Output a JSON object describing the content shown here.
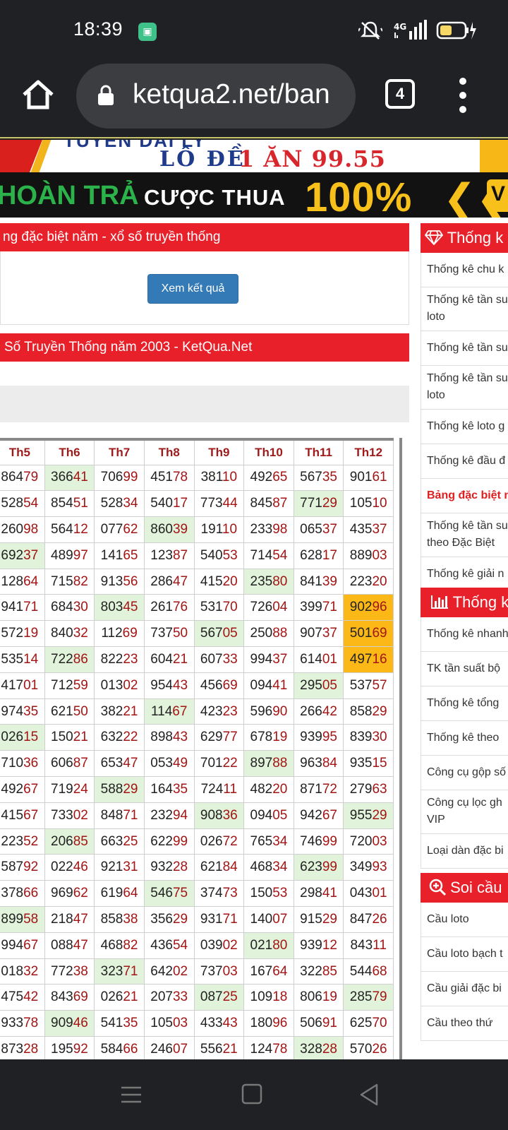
{
  "status": {
    "time": "18:39",
    "network": "4G"
  },
  "browser": {
    "url": "ketqua2.net/ban",
    "tab_count": "4"
  },
  "banners": {
    "top_line": "TUYEN DAI LY",
    "top_line2": "LÔ ĐỀ",
    "top_line3": "1 ĂN 99.55",
    "second_green": "HOÀN TRẢ",
    "second_white": "CƯỢC THUA",
    "second_yellow": "100%",
    "second_chevrons": "❮❮",
    "second_tail": "V"
  },
  "panel1": {
    "title": "ng đặc biệt năm - xổ số truyền thống",
    "button": "Xem kết quả"
  },
  "panel2": {
    "title": "Số Truyền Thống năm 2003 - KetQua.Net"
  },
  "table": {
    "headers": [
      "Th5",
      "Th6",
      "Th7",
      "Th8",
      "Th9",
      "Th10",
      "Th11",
      "Th12"
    ],
    "rows": [
      [
        "86479",
        "36641",
        "70699",
        "45178",
        "38110",
        "49265",
        "56735",
        "90161"
      ],
      [
        "52854",
        "85451",
        "52834",
        "54017",
        "77344",
        "84587",
        "77129",
        "10510"
      ],
      [
        "26098",
        "56412",
        "07762",
        "86039",
        "19110",
        "23398",
        "06537",
        "43537"
      ],
      [
        "69237",
        "48997",
        "14165",
        "12387",
        "54053",
        "71454",
        "62817",
        "88903"
      ],
      [
        "12864",
        "71582",
        "91356",
        "28647",
        "41520",
        "23580",
        "84139",
        "22320"
      ],
      [
        "94171",
        "68430",
        "80345",
        "26176",
        "53170",
        "72604",
        "39971",
        "90296"
      ],
      [
        "57219",
        "84032",
        "11269",
        "73750",
        "56705",
        "25088",
        "90737",
        "50169"
      ],
      [
        "53514",
        "72286",
        "82223",
        "60421",
        "60733",
        "99437",
        "61401",
        "49716"
      ],
      [
        "41701",
        "71259",
        "01302",
        "95443",
        "45669",
        "09441",
        "29505",
        "53757"
      ],
      [
        "97435",
        "62150",
        "38221",
        "11467",
        "42323",
        "59690",
        "26642",
        "85829"
      ],
      [
        "02615",
        "15021",
        "63222",
        "89843",
        "62977",
        "67819",
        "93995",
        "83930"
      ],
      [
        "71036",
        "60687",
        "65347",
        "05349",
        "70122",
        "89788",
        "96384",
        "93515"
      ],
      [
        "49267",
        "71924",
        "58829",
        "16435",
        "72411",
        "48220",
        "87172",
        "27963"
      ],
      [
        "41567",
        "73302",
        "84871",
        "23294",
        "90836",
        "09405",
        "94267",
        "95529"
      ],
      [
        "22352",
        "20685",
        "66325",
        "62299",
        "02672",
        "76534",
        "74699",
        "72003"
      ],
      [
        "58792",
        "02246",
        "92131",
        "93228",
        "62184",
        "46834",
        "62399",
        "34993"
      ],
      [
        "37866",
        "96962",
        "61964",
        "54675",
        "37473",
        "15053",
        "29841",
        "04301"
      ],
      [
        "89958",
        "21847",
        "85838",
        "35629",
        "93171",
        "14007",
        "91529",
        "84726"
      ],
      [
        "99467",
        "08847",
        "46882",
        "43654",
        "03902",
        "02180",
        "93912",
        "84311"
      ],
      [
        "01832",
        "77238",
        "32371",
        "64202",
        "73703",
        "16764",
        "32285",
        "54468"
      ],
      [
        "47542",
        "84369",
        "02621",
        "20733",
        "08725",
        "10918",
        "80619",
        "28579"
      ],
      [
        "93378",
        "90946",
        "54135",
        "10503",
        "43343",
        "18096",
        "50691",
        "62570"
      ],
      [
        "87328",
        "19592",
        "58466",
        "24607",
        "55621",
        "12478",
        "32828",
        "57026"
      ]
    ],
    "green_cells": [
      [
        0,
        1
      ],
      [
        1,
        6
      ],
      [
        2,
        3
      ],
      [
        3,
        0
      ],
      [
        4,
        5
      ],
      [
        5,
        2
      ],
      [
        6,
        4
      ],
      [
        7,
        1
      ],
      [
        8,
        6
      ],
      [
        9,
        3
      ],
      [
        10,
        0
      ],
      [
        11,
        5
      ],
      [
        12,
        2
      ],
      [
        13,
        4
      ],
      [
        13,
        7
      ],
      [
        14,
        1
      ],
      [
        15,
        6
      ],
      [
        16,
        3
      ],
      [
        17,
        0
      ],
      [
        18,
        5
      ],
      [
        19,
        2
      ],
      [
        20,
        4
      ],
      [
        20,
        7
      ],
      [
        21,
        1
      ],
      [
        22,
        6
      ]
    ],
    "orange_cells": [
      [
        5,
        7
      ],
      [
        6,
        7
      ],
      [
        7,
        7
      ]
    ]
  },
  "sidebar": {
    "section1": {
      "title": "Thống k",
      "items": [
        "Thống kê chu k",
        "Thống kê tần su\nloto",
        "Thống kê tần su",
        "Thống kê tần su\nloto",
        "Thống kê loto g",
        "Thống kê đầu đ",
        "Bảng đặc biệt n",
        "Thống kê tần su\ntheo Đặc Biệt",
        "Thống kê giải n"
      ]
    },
    "section2": {
      "title": "Thống k",
      "items": [
        "Thống kê nhanh",
        "TK tần suất bộ",
        "Thống kê tổng",
        "Thống kê theo",
        "Công cụ gộp số",
        "Công cụ lọc gh\nVIP",
        "Loại dàn đặc bi"
      ]
    },
    "section3": {
      "title": "Soi cầu",
      "items": [
        "Cầu loto",
        "Cầu loto bạch t",
        "Cầu giải đặc bi",
        "Cầu theo thứ"
      ]
    }
  },
  "colors": {
    "header_red": "#e8202a",
    "button_blue": "#337ab7",
    "number_red": "#a31414",
    "highlight_green": "#e1f3da",
    "highlight_orange": "#fbb817"
  }
}
